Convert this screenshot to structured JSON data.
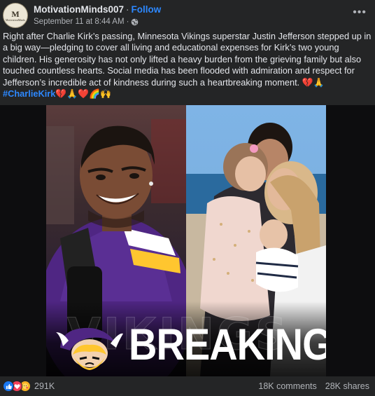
{
  "header": {
    "avatar_letter": "M",
    "avatar_sub": "MotivationMinds",
    "page_name": "MotivationMinds007",
    "separator": "·",
    "follow_label": "Follow",
    "timestamp": "September 11 at 8:44 AM",
    "meta_separator": "·",
    "privacy_icon": "globe-icon",
    "more_icon": "more-options-icon",
    "more_glyph": "•••"
  },
  "caption": {
    "text": "Right after Charlie Kirk’s passing, Minnesota Vikings superstar Justin Jefferson stepped up in a big way—pledging to cover all living and educational expenses for Kirk’s two young children. His generosity has not only lifted a heavy burden from the grieving family but also touched countless hearts. Social media has been flooded with admiration and respect for Jefferson’s incredible act of kindness during such a heartbreaking moment. 💔🙏",
    "hashtag": "#CharlieKirk",
    "hashtag_emojis": "💔🙏❤️🌈🙌"
  },
  "media": {
    "headline": "BREAKING",
    "watermark": "VIKINGS"
  },
  "footer": {
    "reaction_icons": [
      "like-icon",
      "love-icon",
      "care-icon"
    ],
    "reaction_count": "291K",
    "comments": "18K comments",
    "shares": "28K shares"
  },
  "colors": {
    "background": "#242526",
    "text_primary": "#e4e6eb",
    "text_secondary": "#b0b3b8",
    "link": "#2d88ff",
    "vikings_purple": "#4f2683",
    "vikings_gold": "#ffc62f"
  }
}
